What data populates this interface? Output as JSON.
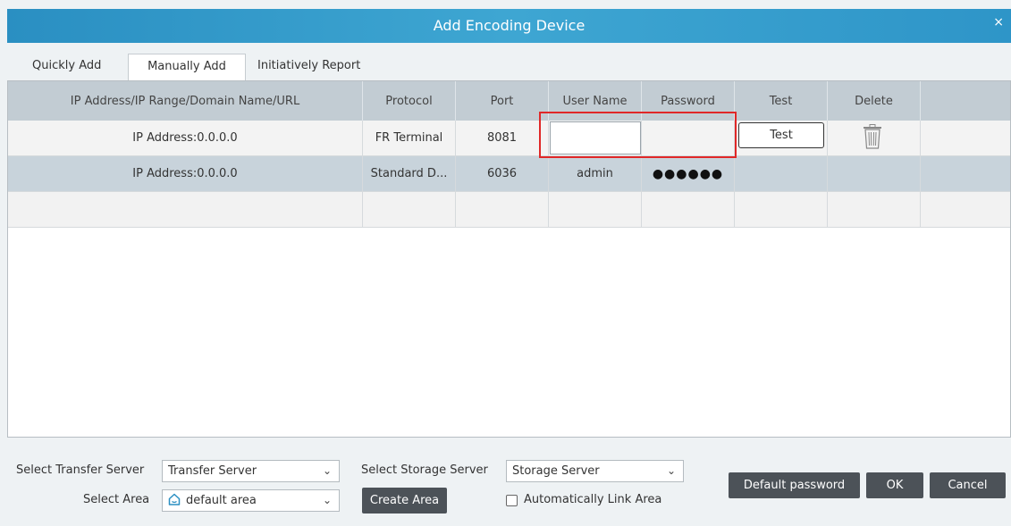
{
  "window": {
    "title": "Add Encoding Device",
    "close_glyph": "×"
  },
  "tabs": [
    {
      "label": "Quickly Add"
    },
    {
      "label": "Manually Add"
    },
    {
      "label": "Initiatively Report"
    }
  ],
  "table": {
    "headers": [
      "IP Address/IP Range/Domain Name/URL",
      "Protocol",
      "Port",
      "User Name",
      "Password",
      "Test",
      "Delete",
      ""
    ],
    "rows": [
      {
        "address": "IP Address:0.0.0.0",
        "protocol": "FR Terminal",
        "port": "8081",
        "username": "",
        "password": "",
        "test_label": "Test"
      },
      {
        "address": "IP Address:0.0.0.0",
        "protocol": "Standard D...",
        "port": "6036",
        "username": "admin",
        "password": "●●●●●●"
      }
    ]
  },
  "footer": {
    "transfer_server_label": "Select Transfer Server",
    "transfer_server_value": "Transfer Server",
    "storage_server_label": "Select Storage Server",
    "storage_server_value": "Storage Server",
    "area_label": "Select Area",
    "area_value": "default area",
    "create_area": "Create Area",
    "auto_link_area": "Automatically Link Area",
    "auto_link_checked": false,
    "default_password": "Default password",
    "ok": "OK",
    "cancel": "Cancel"
  },
  "icons": {
    "dropdown": "chevron-down-icon",
    "area": "home-icon",
    "delete": "trash-icon"
  },
  "colors": {
    "titlebar": "#3ea6d2",
    "header_row": "#c2ccd3",
    "selected_row": "#c8d3db",
    "highlight": "#e02828",
    "dark_button": "#4c5258"
  }
}
